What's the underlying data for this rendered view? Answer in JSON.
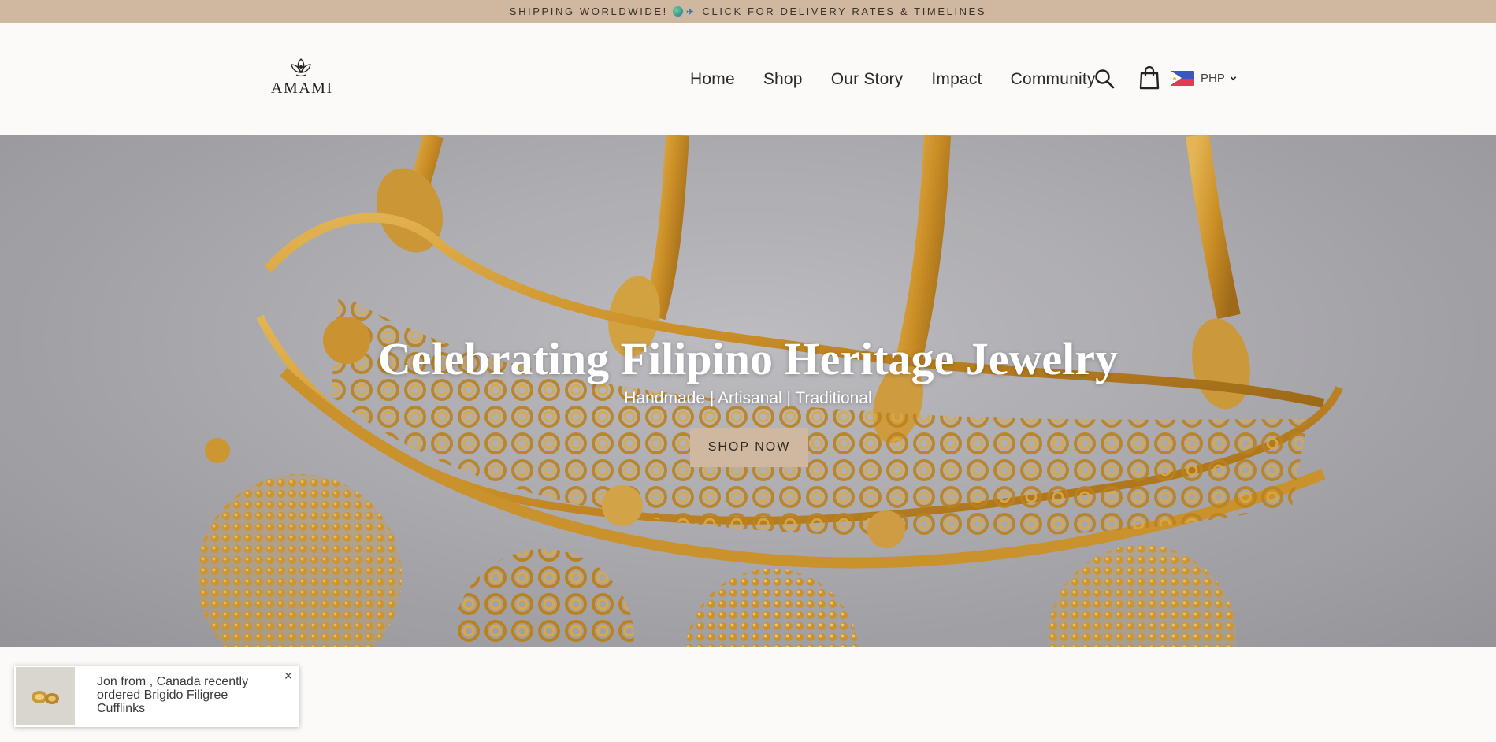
{
  "announcement": {
    "text_before": "SHIPPING WORLDWIDE!",
    "text_after": "CLICK FOR DELIVERY RATES & TIMELINES"
  },
  "header": {
    "logo_text": "AMAMI",
    "nav": [
      "Home",
      "Shop",
      "Our Story",
      "Impact",
      "Community"
    ],
    "currency": "PHP"
  },
  "hero": {
    "title": "Celebrating Filipino Heritage Jewelry",
    "subtitle": "Handmade | Artisanal | Traditional",
    "cta": "SHOP NOW"
  },
  "toast": {
    "line1": "Jon from , Canada recently",
    "line2": "ordered Brigido Filigree",
    "line3": "Cufflinks",
    "close": "×"
  },
  "colors": {
    "announcement_bg": "#cfb7a0",
    "page_bg": "#fcfaf8",
    "gold": "#d9a22a",
    "flag_blue": "#3a57c2",
    "flag_red": "#de3c50"
  },
  "icons": [
    "globe-icon",
    "airplane-icon",
    "search-icon",
    "shopping-bag-icon",
    "chevron-down-icon",
    "close-icon",
    "logo-flower-icon"
  ]
}
